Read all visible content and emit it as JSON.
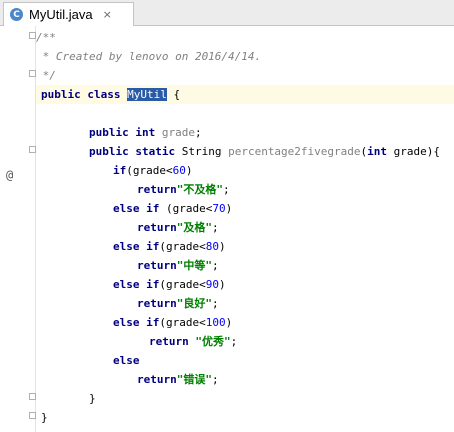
{
  "tab": {
    "icon_letter": "C",
    "label": "MyUtil.java",
    "close": "×"
  },
  "gutter": {
    "override_marker": "@"
  },
  "code": {
    "l1": "/**",
    "l2": " * Created by lenovo on 2016/4/14.",
    "l3": " */",
    "l4_kw": "public class ",
    "l4_name": "MyUtil",
    "l4_rest": " {",
    "l5_kw": "public int ",
    "l5_field": "grade",
    "l5_end": ";",
    "l6_kw": "public static ",
    "l6_type": "String ",
    "l6_method": "percentage2fivegrade",
    "l6_open": "(",
    "l6_kw2": "int ",
    "l6_param": "grade",
    "l6_close": "){",
    "c1_kw": "if",
    "c1_a": "(grade<",
    "c1_n": "60",
    "c1_b": ")",
    "r1_kw": "return",
    "r1_s": "\"不及格\"",
    "r1_e": ";",
    "c2_kw": "else if ",
    "c2_a": "(grade<",
    "c2_n": "70",
    "c2_b": ")",
    "r2_kw": "return",
    "r2_s": "\"及格\"",
    "r2_e": ";",
    "c3_kw": "else if",
    "c3_a": "(grade<",
    "c3_n": "80",
    "c3_b": ")",
    "r3_kw": "return",
    "r3_s": "\"中等\"",
    "r3_e": ";",
    "c4_kw": "else if",
    "c4_a": "(grade<",
    "c4_n": "90",
    "c4_b": ")",
    "r4_kw": "return",
    "r4_s": "\"良好\"",
    "r4_e": ";",
    "c5_kw": "else if",
    "c5_a": "(grade<",
    "c5_n": "100",
    "c5_b": ")",
    "r5_kw": "return ",
    "r5_s": "\"优秀\"",
    "r5_e": ";",
    "c6_kw": "else",
    "r6_kw": "return",
    "r6_s": "\"错误\"",
    "r6_e": ";",
    "close_method": "}",
    "close_class": "}"
  },
  "colors": {
    "keyword": "#000080",
    "string": "#008000",
    "number": "#0000ff",
    "comment": "#808080",
    "current_line": "#fffae3",
    "selection": "#2a5ba8"
  }
}
